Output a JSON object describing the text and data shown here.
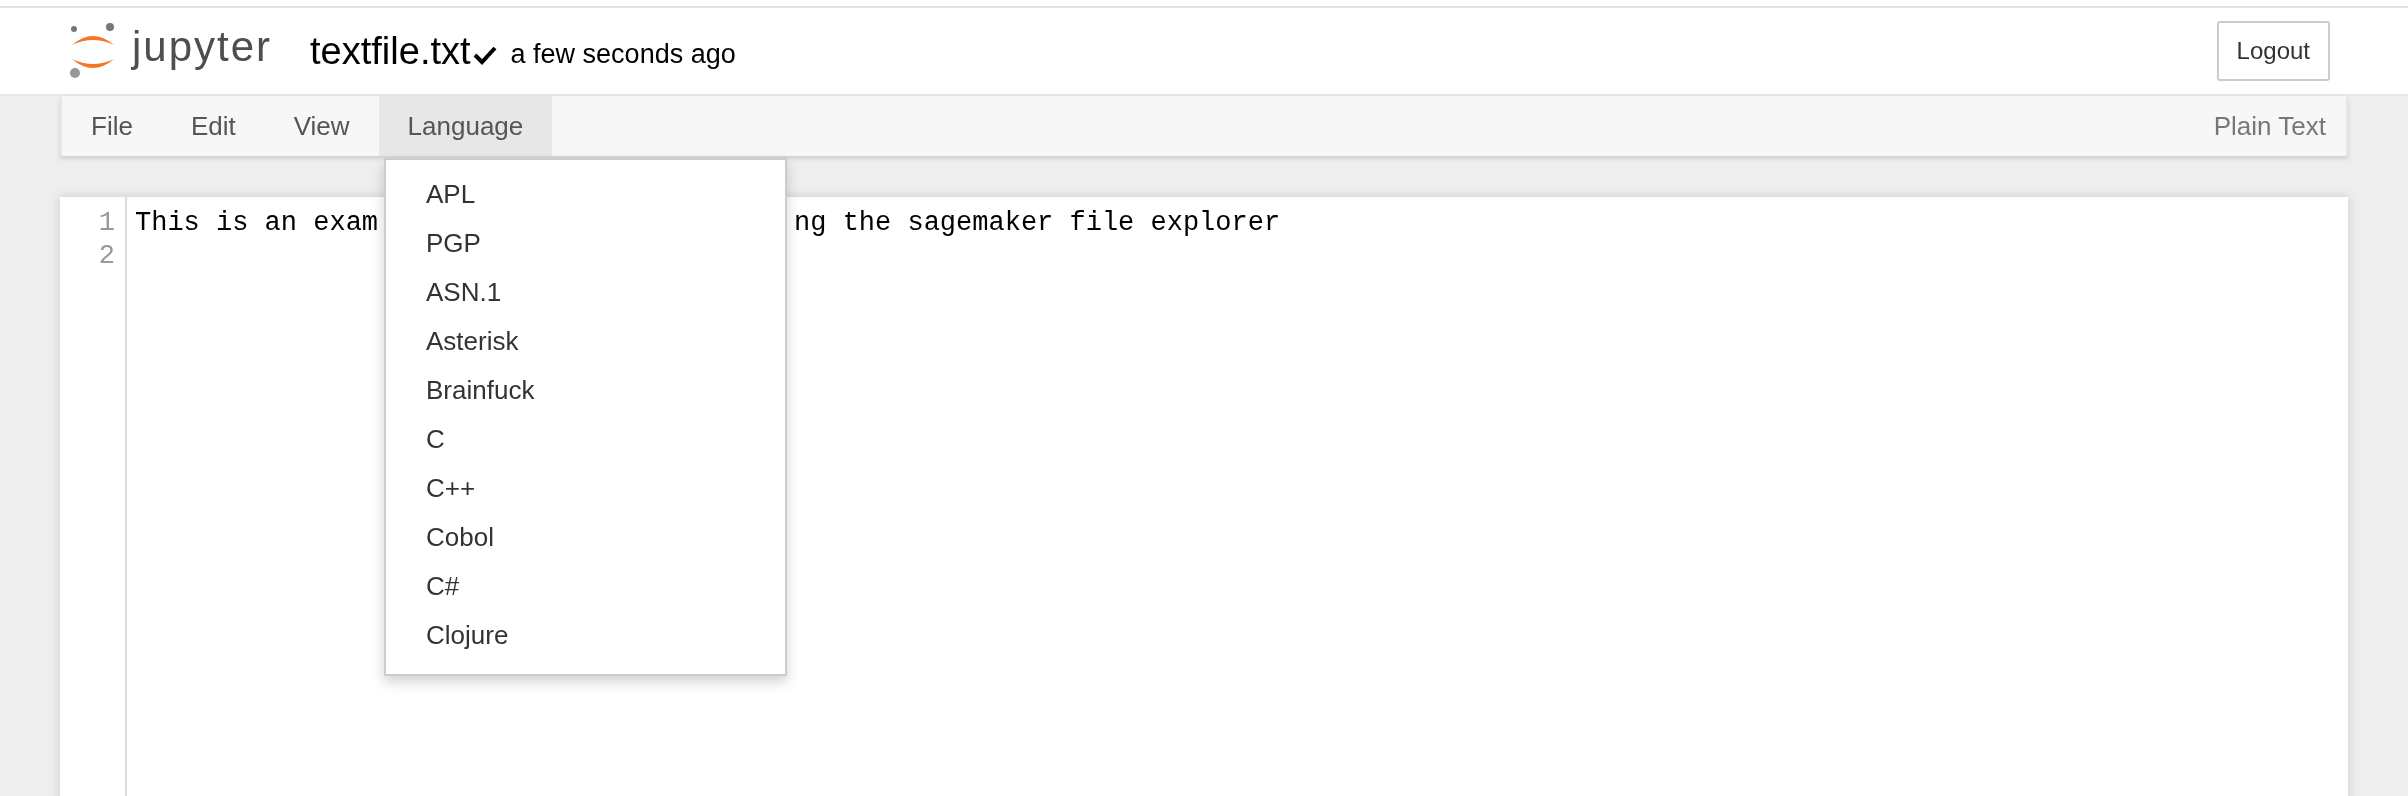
{
  "header": {
    "logo_text": "jupyter",
    "file_name": "textfile.txt",
    "saved": true,
    "save_status": "a few seconds ago",
    "logout_button": "Logout"
  },
  "menu_bar": {
    "items": [
      {
        "label": "File",
        "selected": false
      },
      {
        "label": "Edit",
        "selected": false
      },
      {
        "label": "View",
        "selected": false
      },
      {
        "label": "Language",
        "selected": true
      }
    ],
    "mode": "Plain Text"
  },
  "language_menu": {
    "items": [
      "APL",
      "PGP",
      "ASN.1",
      "Asterisk",
      "Brainfuck",
      "C",
      "C++",
      "Cobol",
      "C#",
      "Clojure"
    ]
  },
  "editor": {
    "lines": [
      {
        "number": "1",
        "visible_parts": [
          "This is an exam",
          "ng the sagemaker file explorer"
        ]
      },
      {
        "number": "2"
      }
    ]
  }
}
